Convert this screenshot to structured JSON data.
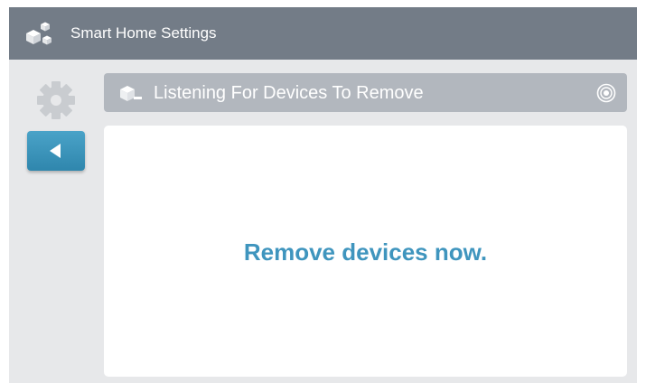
{
  "app": {
    "title": "Smart Home Settings",
    "logo_icon": "cubes-logo-icon"
  },
  "sidebar": {
    "settings_icon": "gear-icon",
    "back_button_icon": "triangle-left-icon"
  },
  "header": {
    "title": "Listening For Devices To Remove",
    "icon": "cube-minus-icon",
    "status_icon": "target-icon"
  },
  "main": {
    "message": "Remove devices now."
  },
  "colors": {
    "titlebar": "#737c87",
    "background": "#e7e8ea",
    "header": "#b2b7be",
    "accent": "#3f95be",
    "button": "#3b95bb"
  }
}
